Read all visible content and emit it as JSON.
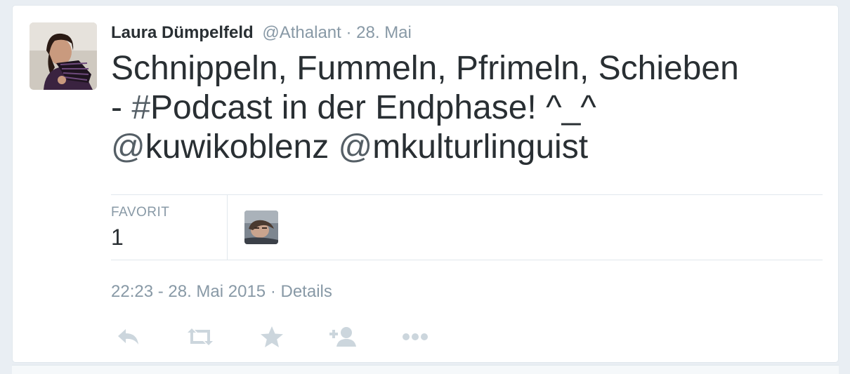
{
  "tweet": {
    "author": {
      "full_name": "Laura Dümpelfeld",
      "username": "@Athalant",
      "avatar_icon": "profile-photo"
    },
    "separator": "·",
    "date": "28. Mai",
    "text": {
      "line1": "Schnippeln, Fummeln, Pfrimeln, Schieben",
      "line2_prefix": "- ",
      "hashtag_symbol": "#",
      "hashtag": "Podcast",
      "line2_suffix": " in der Endphase! ^_^",
      "mention_symbol_1": "@",
      "mention_1": "kuwikoblenz",
      "mention_symbol_2": "@",
      "mention_2": "mkulturlinguist"
    },
    "stats": {
      "favorites_label": "FAVORIT",
      "favorites_count": "1"
    },
    "meta": {
      "timestamp": "22:23 - 28. Mai 2015",
      "separator": "·",
      "details_label": "Details"
    },
    "actions": [
      {
        "name": "reply-icon"
      },
      {
        "name": "retweet-icon"
      },
      {
        "name": "favorite-star-icon"
      },
      {
        "name": "follow-icon"
      },
      {
        "name": "more-icon"
      }
    ]
  },
  "colors": {
    "text_primary": "#292f33",
    "text_muted": "#8899a6",
    "icon": "#ccd6dd",
    "border": "#e1e8ed",
    "page_bg": "#e9eef3"
  }
}
